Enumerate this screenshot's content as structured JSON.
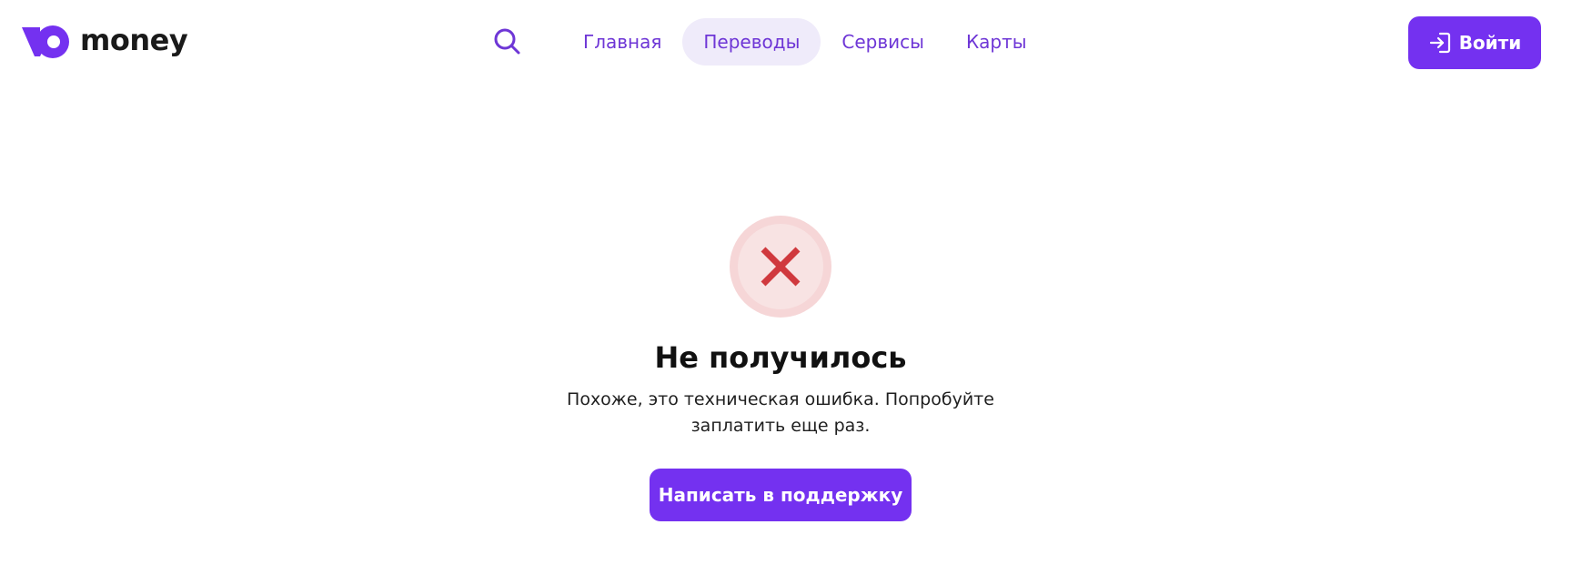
{
  "header": {
    "logo": {
      "text": "money",
      "icon": "yoomoney-logo-icon",
      "color": "#7431f0"
    },
    "nav": {
      "search_icon": "search-icon",
      "items": [
        {
          "label": "Главная",
          "active": false
        },
        {
          "label": "Переводы",
          "active": true
        },
        {
          "label": "Сервисы",
          "active": false
        },
        {
          "label": "Карты",
          "active": false
        }
      ]
    },
    "login": {
      "label": "Войти",
      "icon": "login-icon"
    }
  },
  "main": {
    "status": {
      "icon": "error-cross-icon",
      "color": "#d0393e"
    },
    "title": "Не получилось",
    "message": "Похоже, это техническая ошибка. Попробуйте заплатить еще раз.",
    "support_button": "Написать в поддержку"
  },
  "colors": {
    "accent": "#7431f0",
    "nav_text": "#6e36d6",
    "nav_active_bg": "#efebfa",
    "error": "#d0393e",
    "error_bg": "#f6d6d7"
  }
}
